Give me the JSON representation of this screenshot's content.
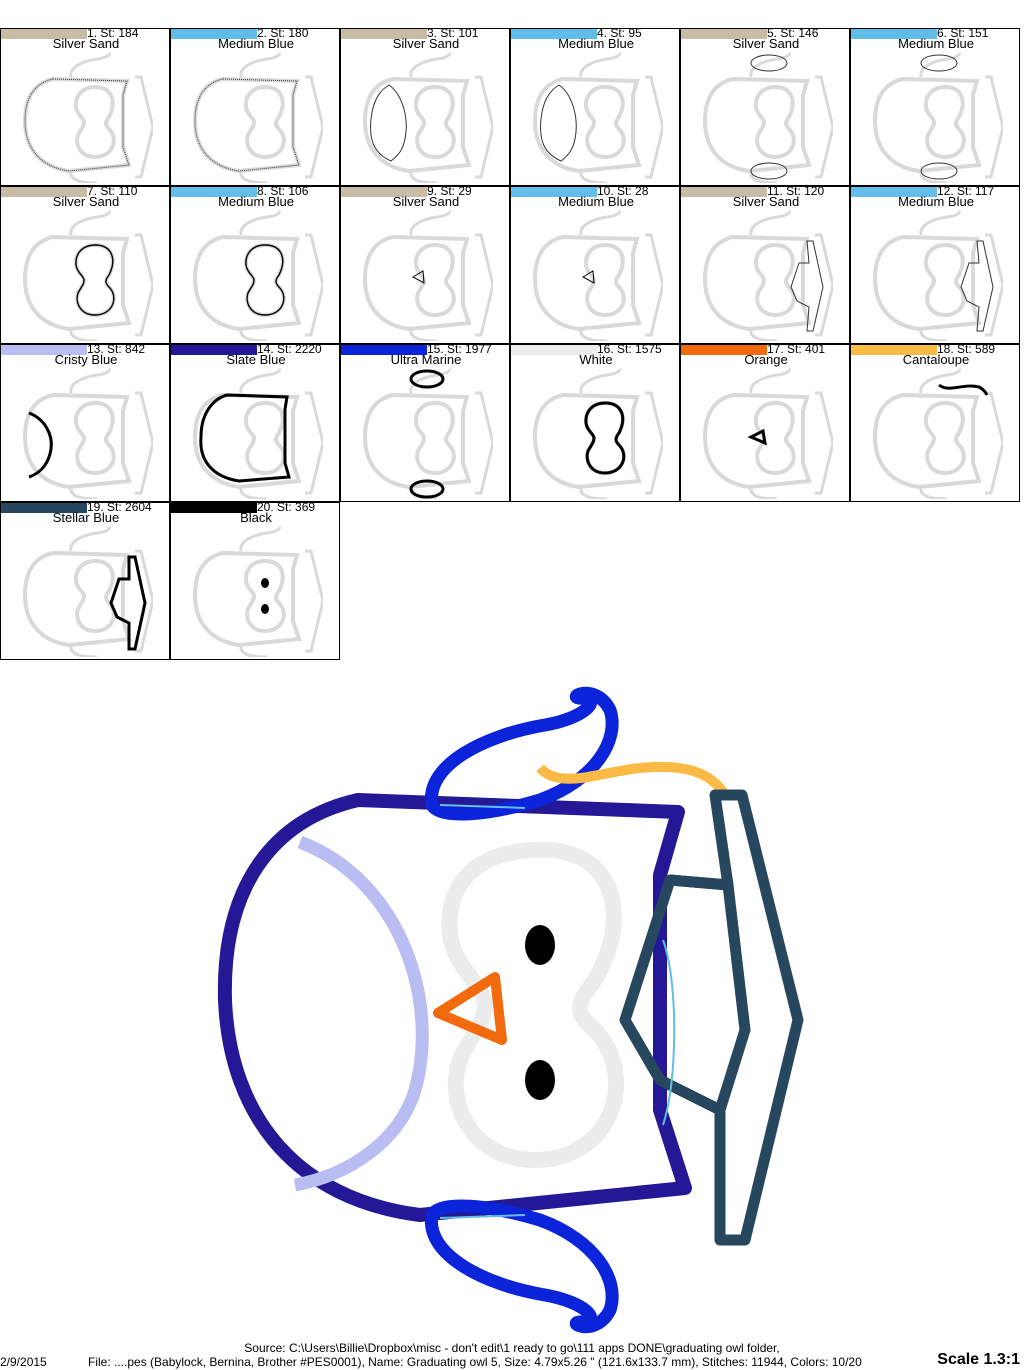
{
  "colors": [
    {
      "num": "1",
      "stitches": "St: 184",
      "name": "Silver Sand",
      "hex": "#c8bca6"
    },
    {
      "num": "2",
      "stitches": "St: 180",
      "name": "Medium Blue",
      "hex": "#62bde9"
    },
    {
      "num": "3",
      "stitches": "St: 101",
      "name": "Silver Sand",
      "hex": "#c8bca6"
    },
    {
      "num": "4",
      "stitches": "St: 95",
      "name": "Medium Blue",
      "hex": "#62bde9"
    },
    {
      "num": "5",
      "stitches": "St: 146",
      "name": "Silver Sand",
      "hex": "#c8bca6"
    },
    {
      "num": "6",
      "stitches": "St: 151",
      "name": "Medium Blue",
      "hex": "#62bde9"
    },
    {
      "num": "7",
      "stitches": "St: 110",
      "name": "Silver Sand",
      "hex": "#c8bca6"
    },
    {
      "num": "8",
      "stitches": "St: 106",
      "name": "Medium Blue",
      "hex": "#62bde9"
    },
    {
      "num": "9",
      "stitches": "St: 29",
      "name": "Silver Sand",
      "hex": "#c8bca6"
    },
    {
      "num": "10",
      "stitches": "St: 28",
      "name": "Medium Blue",
      "hex": "#62bde9"
    },
    {
      "num": "11",
      "stitches": "St: 120",
      "name": "Silver Sand",
      "hex": "#c8bca6"
    },
    {
      "num": "12",
      "stitches": "St: 117",
      "name": "Medium Blue",
      "hex": "#62bde9"
    },
    {
      "num": "13",
      "stitches": "St: 842",
      "name": "Cristy Blue",
      "hex": "#b9bdf2"
    },
    {
      "num": "14",
      "stitches": "St: 2220",
      "name": "Slate Blue",
      "hex": "#241896"
    },
    {
      "num": "15",
      "stitches": "St: 1977",
      "name": "Ultra Marine",
      "hex": "#0b23d9"
    },
    {
      "num": "16",
      "stitches": "St: 1575",
      "name": "White",
      "hex": "#ececec"
    },
    {
      "num": "17",
      "stitches": "St: 401",
      "name": "Orange",
      "hex": "#f26a0e"
    },
    {
      "num": "18",
      "stitches": "St: 589",
      "name": "Cantaloupe",
      "hex": "#fbb946"
    },
    {
      "num": "19",
      "stitches": "St: 2604",
      "name": "Stellar Blue",
      "hex": "#27475f"
    },
    {
      "num": "20",
      "stitches": "St: 369",
      "name": "Black",
      "hex": "#000000"
    }
  ],
  "footer": {
    "source": "Source: C:\\Users\\Billie\\Dropbox\\misc - don't edit\\1 ready to go\\111 apps DONE\\graduating owl folder,",
    "date": "2/9/2015",
    "file": "File: ....pes (Babylock, Bernina, Brother #PES0001), Name: Graduating owl 5, Size: 4.79x5.26 \" (121.6x133.7 mm), Stitches: 11944, Colors: 10/20",
    "scale": "Scale 1.3:1"
  }
}
